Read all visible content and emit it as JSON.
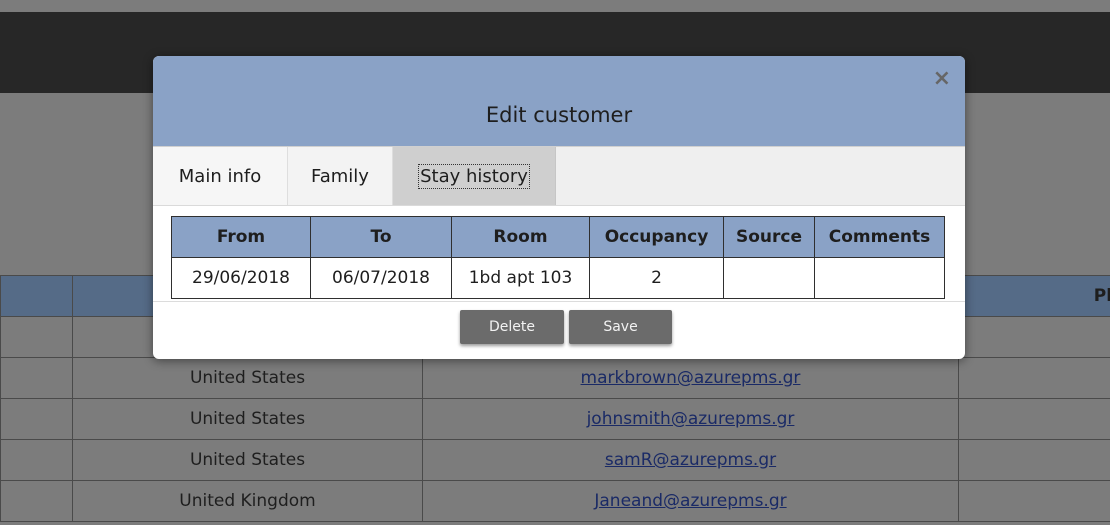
{
  "background": {
    "table_header_partial": "Pho",
    "rows": [
      {
        "country": "United States",
        "email": "markbrown@azurepms.gr"
      },
      {
        "country": "United States",
        "email": "johnsmith@azurepms.gr"
      },
      {
        "country": "United States",
        "email": "samR@azurepms.gr"
      },
      {
        "country": "United Kingdom",
        "email": "Janeand@azurepms.gr"
      }
    ]
  },
  "modal": {
    "title": "Edit customer",
    "close_label": "×",
    "tabs": [
      {
        "label": "Main info"
      },
      {
        "label": "Family"
      },
      {
        "label": "Stay history"
      }
    ],
    "stay_table": {
      "headers": [
        "From",
        "To",
        "Room",
        "Occupancy",
        "Source",
        "Comments"
      ],
      "rows": [
        [
          "29/06/2018",
          "06/07/2018",
          "1bd apt 103",
          "2",
          "",
          ""
        ]
      ]
    },
    "buttons": {
      "delete_label": "Delete",
      "save_label": "Save"
    }
  }
}
